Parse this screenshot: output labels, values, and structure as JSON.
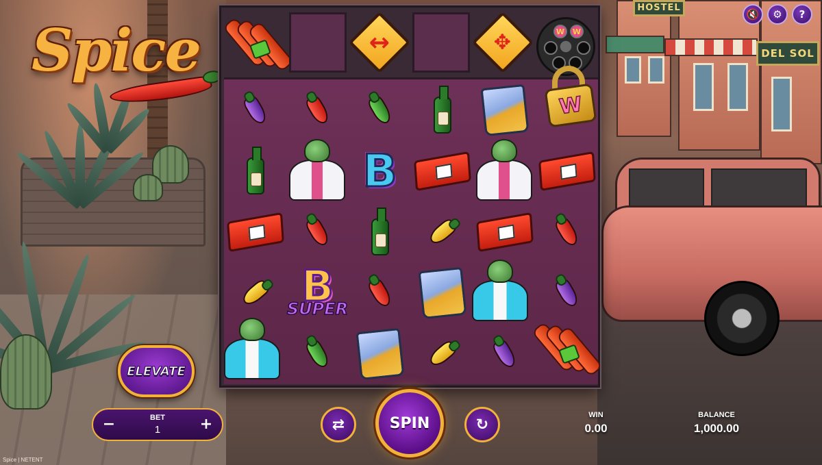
{
  "game": {
    "logo_text": "Spice",
    "footer": "Spice | NETENT"
  },
  "scenery": {
    "sign_hostel": "HOSTEL",
    "sign_del_sol": "DEL SOL"
  },
  "top_icons": [
    {
      "name": "sound-icon",
      "glyph": "🔇"
    },
    {
      "name": "settings-icon",
      "glyph": "⚙"
    },
    {
      "name": "help-icon",
      "glyph": "?"
    }
  ],
  "top_reel": [
    "dynamite",
    "empty",
    "arrow-horizontal",
    "empty",
    "arrow-four-way",
    "revolver-cylinder"
  ],
  "grid": {
    "columns": 6,
    "rows": 5,
    "symbols": [
      [
        "purple-pepper",
        "red-pepper",
        "green-pepper",
        "green-bottle",
        "gold-bag",
        "wild-lock"
      ],
      [
        "green-bottle",
        "white-suit-turtle",
        "blue-B",
        "red-brick",
        "white-suit-turtle",
        "red-brick"
      ],
      [
        "red-brick",
        "red-pepper",
        "green-bottle",
        "yellow-pepper",
        "red-brick",
        "red-pepper"
      ],
      [
        "yellow-pepper",
        "super-B",
        "red-pepper",
        "gold-bag",
        "blue-shirt-turtle",
        "purple-pepper"
      ],
      [
        "blue-shirt-turtle",
        "green-pepper",
        "gold-bag",
        "yellow-pepper",
        "purple-pepper",
        "dynamite"
      ]
    ]
  },
  "symbol_text": {
    "big_b": "B",
    "super_b_letter": "B",
    "super_b_label": "SUPER",
    "wild_letter": "W"
  },
  "controls": {
    "elevate_label": "ELEVATE",
    "bet_label": "BET",
    "bet_value": "1",
    "bet_minus": "−",
    "bet_plus": "+",
    "spin_label": "SPIN",
    "autoplay_icon": "↻",
    "turbo_icon": "⇄",
    "win_label": "WIN",
    "win_value": "0.00",
    "balance_label": "BALANCE",
    "balance_value": "1,000.00"
  },
  "colors": {
    "accent_gold": "#f2b23a",
    "button_purple": "#5a0e86",
    "reel_bg": "#6e3058"
  }
}
